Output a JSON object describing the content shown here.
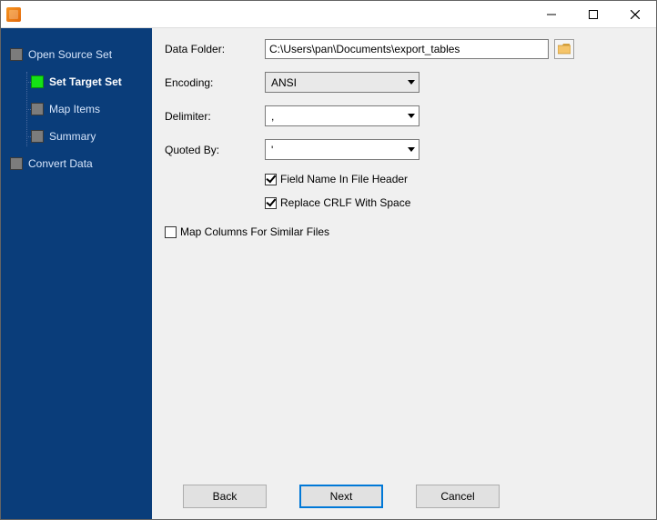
{
  "sidebar": {
    "open_source_set": "Open Source Set",
    "set_target_set": "Set Target Set",
    "map_items": "Map Items",
    "summary": "Summary",
    "convert_data": "Convert Data"
  },
  "form": {
    "data_folder_label": "Data Folder:",
    "data_folder_value": "C:\\Users\\pan\\Documents\\export_tables",
    "encoding_label": "Encoding:",
    "encoding_value": "ANSI",
    "delimiter_label": "Delimiter:",
    "delimiter_value": ",",
    "quoted_by_label": "Quoted By:",
    "quoted_by_value": "'",
    "field_name_header_label": "Field Name In File Header",
    "replace_crlf_label": "Replace CRLF With Space",
    "map_columns_label": "Map Columns For Similar Files"
  },
  "buttons": {
    "back": "Back",
    "next": "Next",
    "cancel": "Cancel"
  }
}
